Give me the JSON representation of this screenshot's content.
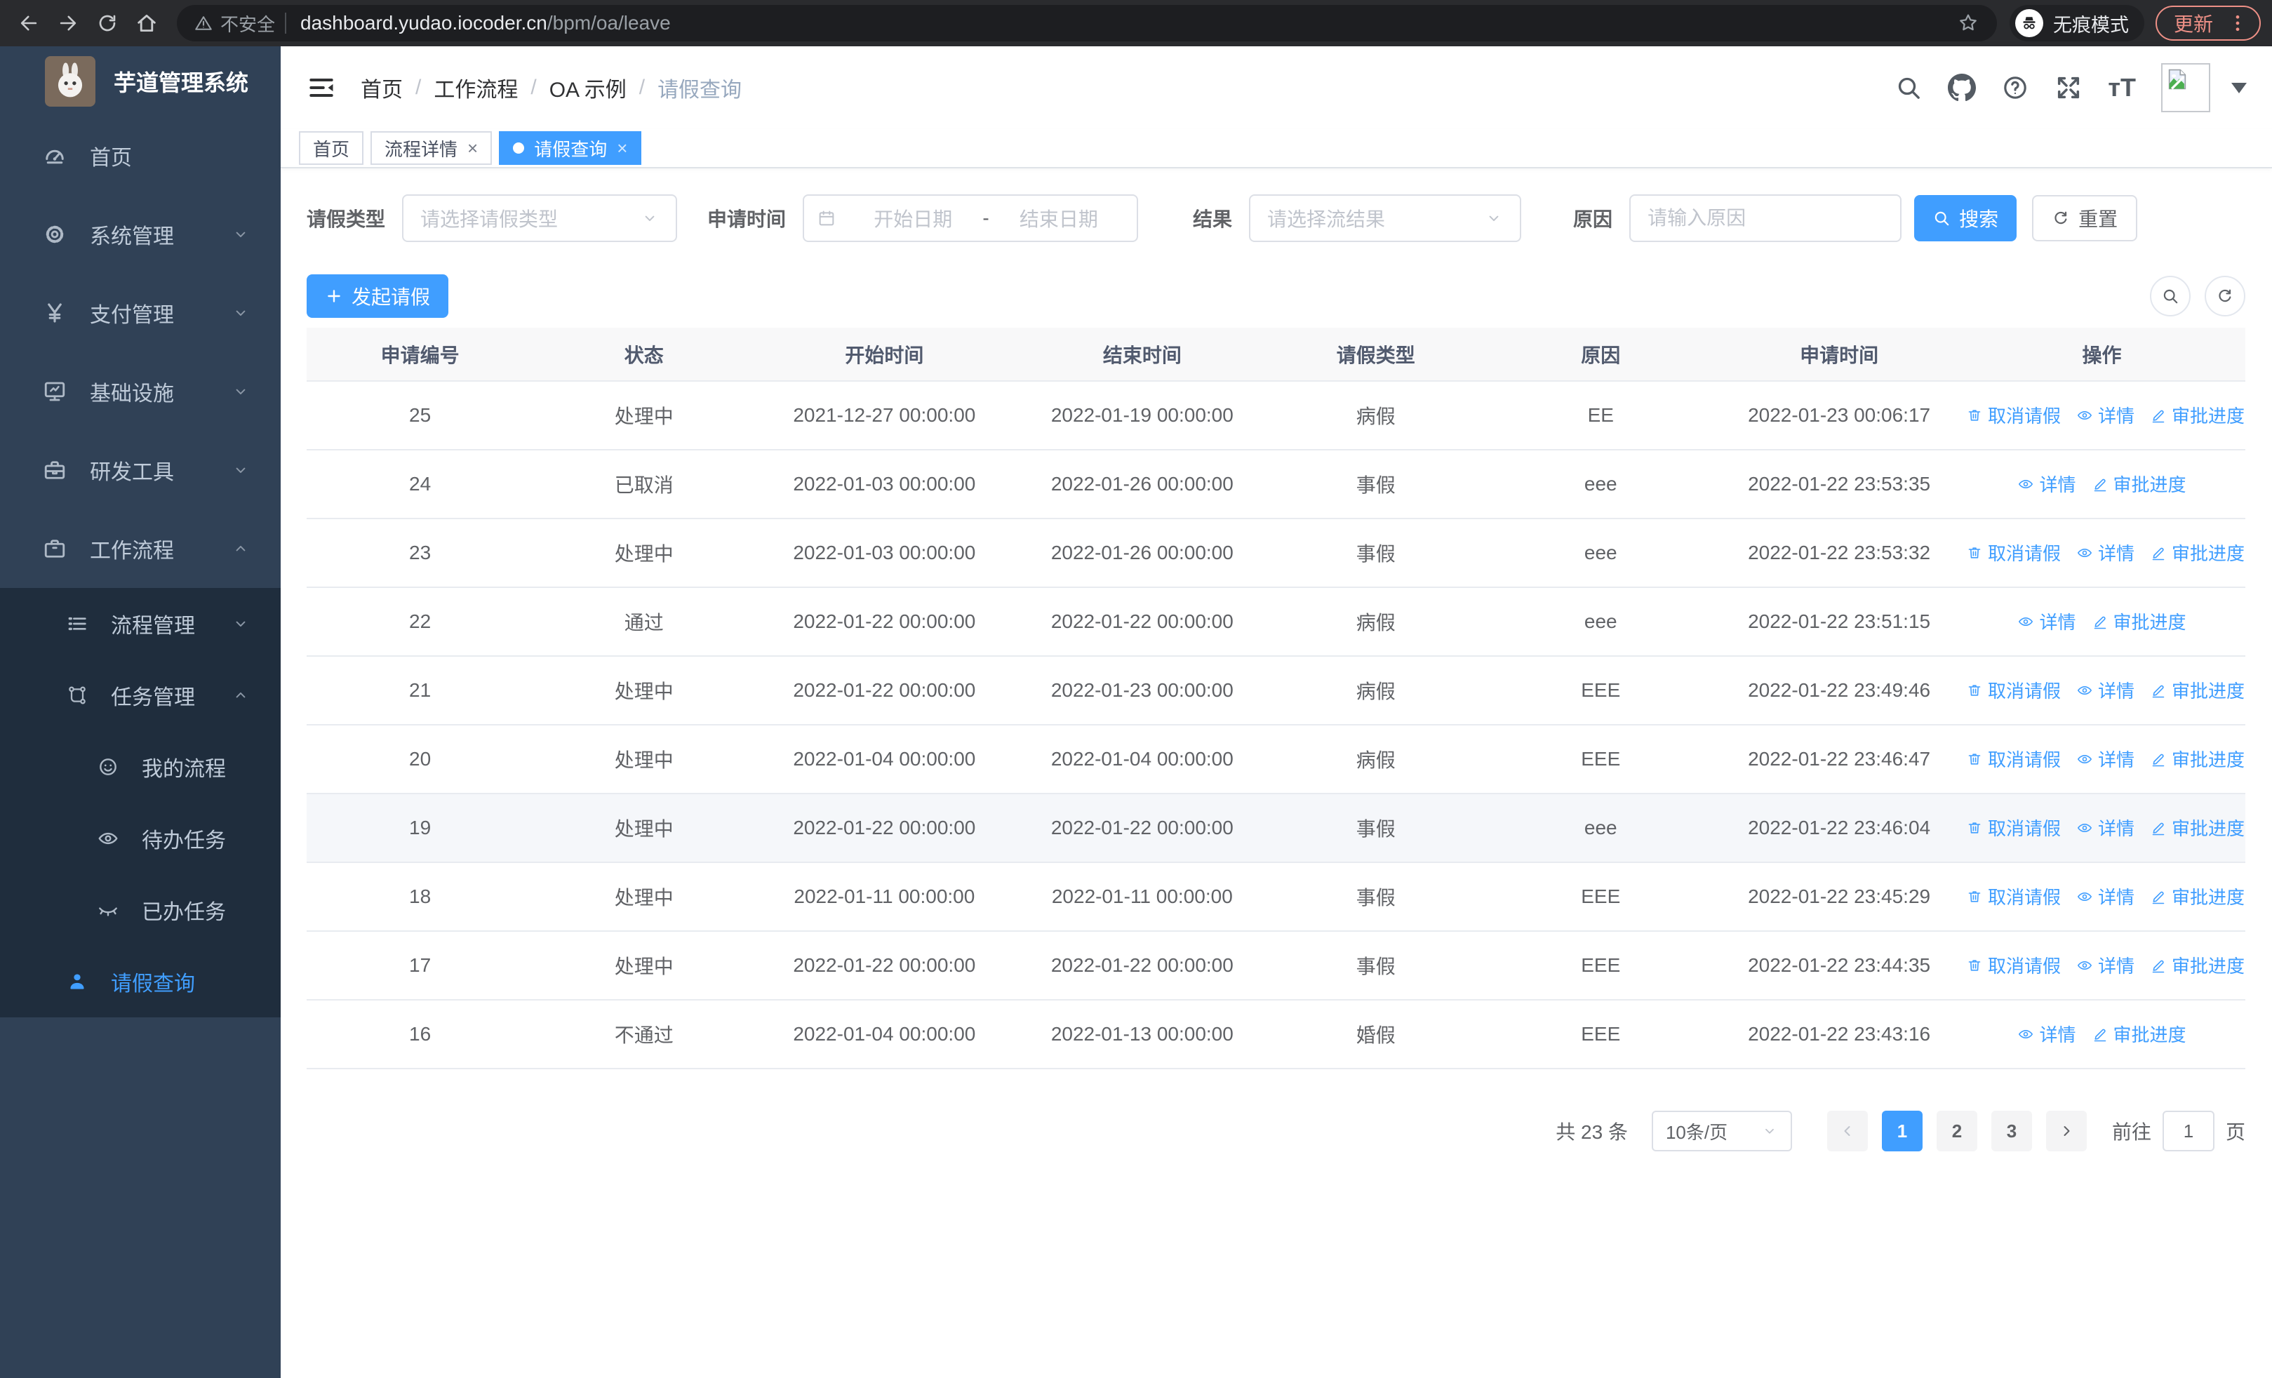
{
  "colors": {
    "accent": "#409eff",
    "sidebar_bg": "#304156",
    "submenu_bg": "#1f2d3d",
    "chrome_update": "#ee9086"
  },
  "browser": {
    "security_label": "不安全",
    "url_host": "dashboard.yudao.iocoder.cn",
    "url_path": "/bpm/oa/leave",
    "incognito_label": "无痕模式",
    "update_label": "更新"
  },
  "sidebar": {
    "app_title": "芋道管理系统",
    "items": [
      {
        "key": "home",
        "label": "首页",
        "icon": "dashboard",
        "level": 1,
        "submenu": false,
        "arrow": "",
        "active": false
      },
      {
        "key": "system",
        "label": "系统管理",
        "icon": "gear",
        "level": 1,
        "submenu": false,
        "arrow": "down",
        "active": false
      },
      {
        "key": "payment",
        "label": "支付管理",
        "icon": "yen",
        "level": 1,
        "submenu": false,
        "arrow": "down",
        "active": false
      },
      {
        "key": "infra",
        "label": "基础设施",
        "icon": "monitor",
        "level": 1,
        "submenu": false,
        "arrow": "down",
        "active": false
      },
      {
        "key": "devtools",
        "label": "研发工具",
        "icon": "toolbox",
        "level": 1,
        "submenu": false,
        "arrow": "down",
        "active": false
      },
      {
        "key": "workflow",
        "label": "工作流程",
        "icon": "briefcase",
        "level": 1,
        "submenu": false,
        "arrow": "up",
        "active": false
      },
      {
        "key": "process-mgmt",
        "label": "流程管理",
        "icon": "list",
        "level": 2,
        "submenu": true,
        "arrow": "down",
        "active": false
      },
      {
        "key": "task-mgmt",
        "label": "任务管理",
        "icon": "flow",
        "level": 2,
        "submenu": true,
        "arrow": "up",
        "active": false
      },
      {
        "key": "my-process",
        "label": "我的流程",
        "icon": "face",
        "level": 3,
        "submenu": true,
        "arrow": "",
        "active": false
      },
      {
        "key": "todo-tasks",
        "label": "待办任务",
        "icon": "eye",
        "level": 3,
        "submenu": true,
        "arrow": "",
        "active": false
      },
      {
        "key": "done-tasks",
        "label": "已办任务",
        "icon": "eye-closed",
        "level": 3,
        "submenu": true,
        "arrow": "",
        "active": false
      },
      {
        "key": "leave-query",
        "label": "请假查询",
        "icon": "user",
        "level": 2,
        "submenu": true,
        "arrow": "",
        "active": true
      }
    ]
  },
  "header": {
    "breadcrumb": [
      "首页",
      "工作流程",
      "OA 示例",
      "请假查询"
    ],
    "breadcrumb_separator": "/"
  },
  "tabs": [
    {
      "key": "home",
      "label": "首页",
      "closable": false,
      "active": false
    },
    {
      "key": "process-detail",
      "label": "流程详情",
      "closable": true,
      "active": false
    },
    {
      "key": "leave-query",
      "label": "请假查询",
      "closable": true,
      "active": true
    }
  ],
  "filters": {
    "leave_type_label": "请假类型",
    "leave_type_placeholder": "请选择请假类型",
    "apply_time_label": "申请时间",
    "date_start_placeholder": "开始日期",
    "date_separator": "-",
    "date_end_placeholder": "结束日期",
    "result_label": "结果",
    "result_placeholder": "请选择流结果",
    "reason_label": "原因",
    "reason_placeholder": "请输入原因",
    "search_label": "搜索",
    "reset_label": "重置"
  },
  "toolbar": {
    "create_label": "发起请假"
  },
  "table": {
    "columns": [
      "申请编号",
      "状态",
      "开始时间",
      "结束时间",
      "请假类型",
      "原因",
      "申请时间",
      "操作"
    ],
    "action_labels": {
      "cancel": "取消请假",
      "detail": "详情",
      "progress": "审批进度"
    },
    "rows": [
      {
        "id": "25",
        "status": "处理中",
        "start_time": "2021-12-27 00:00:00",
        "end_time": "2022-01-19 00:00:00",
        "leave_type": "病假",
        "reason": "EE",
        "apply_time": "2022-01-23 00:06:17",
        "actions": [
          "cancel",
          "detail",
          "progress"
        ],
        "highlighted": false
      },
      {
        "id": "24",
        "status": "已取消",
        "start_time": "2022-01-03 00:00:00",
        "end_time": "2022-01-26 00:00:00",
        "leave_type": "事假",
        "reason": "eee",
        "apply_time": "2022-01-22 23:53:35",
        "actions": [
          "detail",
          "progress"
        ],
        "highlighted": false
      },
      {
        "id": "23",
        "status": "处理中",
        "start_time": "2022-01-03 00:00:00",
        "end_time": "2022-01-26 00:00:00",
        "leave_type": "事假",
        "reason": "eee",
        "apply_time": "2022-01-22 23:53:32",
        "actions": [
          "cancel",
          "detail",
          "progress"
        ],
        "highlighted": false
      },
      {
        "id": "22",
        "status": "通过",
        "start_time": "2022-01-22 00:00:00",
        "end_time": "2022-01-22 00:00:00",
        "leave_type": "病假",
        "reason": "eee",
        "apply_time": "2022-01-22 23:51:15",
        "actions": [
          "detail",
          "progress"
        ],
        "highlighted": false
      },
      {
        "id": "21",
        "status": "处理中",
        "start_time": "2022-01-22 00:00:00",
        "end_time": "2022-01-23 00:00:00",
        "leave_type": "病假",
        "reason": "EEE",
        "apply_time": "2022-01-22 23:49:46",
        "actions": [
          "cancel",
          "detail",
          "progress"
        ],
        "highlighted": false
      },
      {
        "id": "20",
        "status": "处理中",
        "start_time": "2022-01-04 00:00:00",
        "end_time": "2022-01-04 00:00:00",
        "leave_type": "病假",
        "reason": "EEE",
        "apply_time": "2022-01-22 23:46:47",
        "actions": [
          "cancel",
          "detail",
          "progress"
        ],
        "highlighted": false
      },
      {
        "id": "19",
        "status": "处理中",
        "start_time": "2022-01-22 00:00:00",
        "end_time": "2022-01-22 00:00:00",
        "leave_type": "事假",
        "reason": "eee",
        "apply_time": "2022-01-22 23:46:04",
        "actions": [
          "cancel",
          "detail",
          "progress"
        ],
        "highlighted": true
      },
      {
        "id": "18",
        "status": "处理中",
        "start_time": "2022-01-11 00:00:00",
        "end_time": "2022-01-11 00:00:00",
        "leave_type": "事假",
        "reason": "EEE",
        "apply_time": "2022-01-22 23:45:29",
        "actions": [
          "cancel",
          "detail",
          "progress"
        ],
        "highlighted": false
      },
      {
        "id": "17",
        "status": "处理中",
        "start_time": "2022-01-22 00:00:00",
        "end_time": "2022-01-22 00:00:00",
        "leave_type": "事假",
        "reason": "EEE",
        "apply_time": "2022-01-22 23:44:35",
        "actions": [
          "cancel",
          "detail",
          "progress"
        ],
        "highlighted": false
      },
      {
        "id": "16",
        "status": "不通过",
        "start_time": "2022-01-04 00:00:00",
        "end_time": "2022-01-13 00:00:00",
        "leave_type": "婚假",
        "reason": "EEE",
        "apply_time": "2022-01-22 23:43:16",
        "actions": [
          "detail",
          "progress"
        ],
        "highlighted": false
      }
    ]
  },
  "pagination": {
    "total_label": "共 23 条",
    "page_size": "10条/页",
    "pages": [
      "1",
      "2",
      "3"
    ],
    "active_page": "1",
    "goto_label": "前往",
    "goto_value": "1",
    "page_unit": "页"
  }
}
